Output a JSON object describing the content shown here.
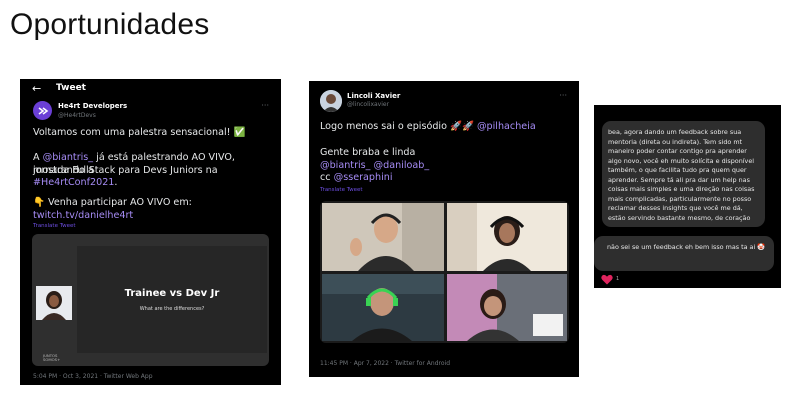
{
  "page": {
    "title": "Oportunidades"
  },
  "tweet1": {
    "topbar": {
      "back_icon": "arrow-left-icon",
      "title": "Tweet"
    },
    "author": {
      "name": "He4rt Developers",
      "handle": "@He4rtDevs"
    },
    "more_icon": "more-icon",
    "lines": {
      "l1": "Voltamos com uma palestra sensacional! ✅",
      "l2_pre": "A ",
      "l2_mention": "@biantris_",
      "l2_post": " já está palestrando AO VIVO, mostrando a",
      "l3": "jornada FullStack para Devs Juniors na",
      "l4_hashtag": "#He4rtConf2021",
      "l4_post": ".",
      "l5": "👇 Venha participar AO VIVO em:",
      "l6_link": "twitch.tv/danielhe4rt"
    },
    "translate": "Translate Tweet",
    "media": {
      "slide_title": "Trainee vs Dev Jr",
      "slide_subtitle": "What are the differences?",
      "logo_text_1": "JUNTOS",
      "logo_text_2": "SOMOS+"
    },
    "footer": "5:04 PM · Oct 3, 2021 · Twitter Web App"
  },
  "tweet2": {
    "author": {
      "name": "Lincoli Xavier",
      "handle": "@lincolixavier"
    },
    "more_icon": "more-icon",
    "lines": {
      "l1_pre": "Logo menos sai o episódio 🚀🚀 ",
      "l1_mention": "@pilhacheia",
      "l2": "Gente braba e linda",
      "l3_m1": "@biantris_",
      "l3_m2": "@daniloab_",
      "l4_pre": "cc ",
      "l4_mention": "@sseraphini"
    },
    "translate": "Translate Tweet",
    "footer": "11:45 PM · Apr 7, 2022 · Twitter for Android"
  },
  "chat": {
    "message1": "bea, agora dando um feedback sobre sua mentoria (direta ou indireta). Tem sido mt maneiro poder contar contigo pra aprender algo novo, você eh muito solícita e disponível também, o que facilita tudo pra quem quer aprender. Sempre tá ali pra dar um help nas coisas mais simples e uma direção nas coisas mais complicadas, particularmente no posso reclamar desses insights que você me dá, estão servindo bastante mesmo, de coração",
    "message2": "não sei se um feedback eh bem isso mas ta ai 🤡",
    "reaction_icon": "heart-icon",
    "reaction_count": "1"
  },
  "colors": {
    "link": "#a68cf5",
    "background_dark": "#000000",
    "bubble": "#2e2e2e",
    "heart": "#e0245e"
  }
}
